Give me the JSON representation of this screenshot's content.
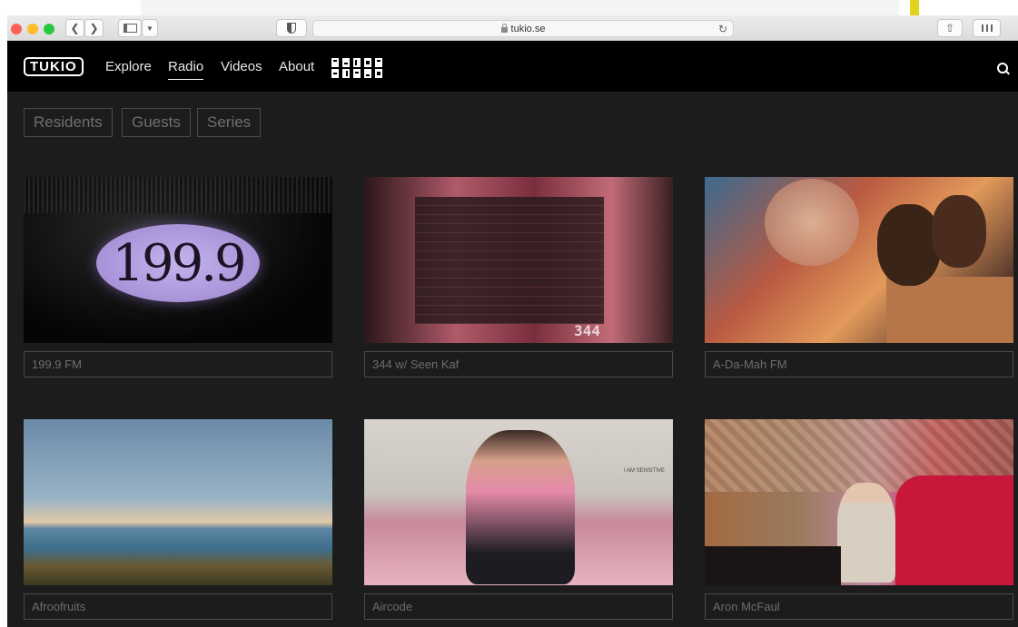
{
  "browser": {
    "url": "tukio.se",
    "icons": [
      "chevron-left-icon",
      "chevron-right-icon",
      "sidebar-icon",
      "shield-icon",
      "lock-icon",
      "reload-icon",
      "share-icon",
      "tabs-grid-icon"
    ],
    "traffic_colors": [
      "#ff5f57",
      "#ffbd2e",
      "#28c840"
    ]
  },
  "site": {
    "logo": "TUKIO",
    "nav": [
      {
        "label": "Explore",
        "active": false
      },
      {
        "label": "Radio",
        "active": true
      },
      {
        "label": "Videos",
        "active": false
      },
      {
        "label": "About",
        "active": false
      }
    ],
    "filters": [
      "Residents",
      "Guests",
      "Series"
    ],
    "cards": [
      {
        "title": "199.9 FM",
        "thumb_text": "199.9"
      },
      {
        "title": "344 w/ Seen Kaf",
        "thumb_text": "344"
      },
      {
        "title": "A-Da-Mah FM"
      },
      {
        "title": "Afroofruits"
      },
      {
        "title": "Aircode",
        "thumb_text": "I AM SENSITIVE"
      },
      {
        "title": "Aron McFaul"
      }
    ],
    "colors": {
      "background": "#1c1c1c",
      "nav": "#000000",
      "border": "#4a4a4a",
      "muted_text": "#6d6d6d"
    }
  }
}
